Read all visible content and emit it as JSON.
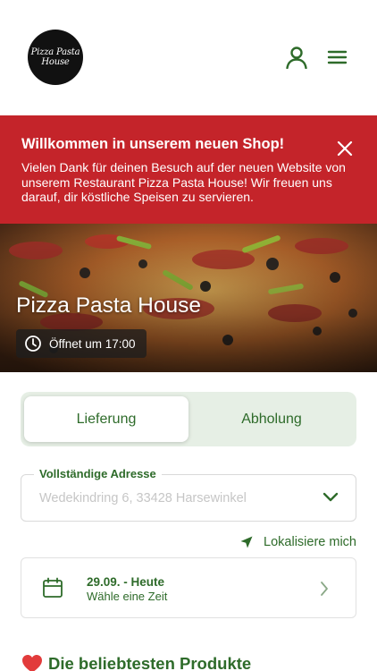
{
  "header": {
    "logo_lines": [
      "Pizza Pasta",
      "House"
    ]
  },
  "banner": {
    "title": "Willkommen in unserem neuen Shop!",
    "text": "Vielen Dank für deinen Besuch auf der neuen Website von unserem Restaurant Pizza Pasta House! Wir freuen uns darauf, dir köstliche Speisen zu servieren.",
    "background": "#c4242a"
  },
  "hero": {
    "title": "Pizza Pasta House",
    "hours": "Öffnet um 17:00"
  },
  "order_mode": {
    "options": [
      {
        "label": "Lieferung",
        "active": true
      },
      {
        "label": "Abholung",
        "active": false
      }
    ]
  },
  "address": {
    "label": "Vollständige Adresse",
    "placeholder": "Wedekindring 6, 33428 Harsewinkel"
  },
  "locate": {
    "label": "Lokalisiere mich"
  },
  "date": {
    "title": "29.09. - Heute",
    "subtitle": "Wähle eine Zeit"
  },
  "popular": {
    "title": "Die beliebtesten Produkte"
  },
  "colors": {
    "accent": "#2e6b2a",
    "toggle_bg": "#e6efe5",
    "banner": "#c4242a"
  }
}
